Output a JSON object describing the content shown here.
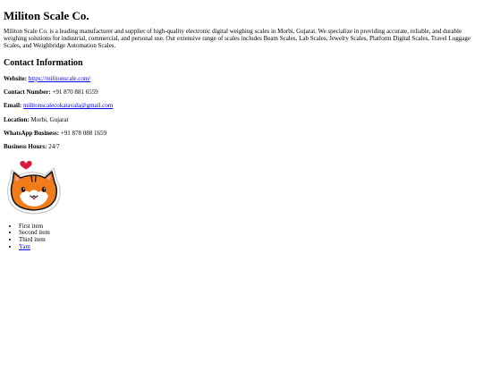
{
  "page": {
    "title": "Militon Scale Co.",
    "description": "Militon Scale Co. is a leading manufacturer and supplier of high-quality electronic digital weighing scales in Morbi, Gujarat. We specialize in providing accurate, reliable, and durable weighing solutions for industrial, commercial, and personal use. Our extensive range of scales includes Beam Scales, Lab Scales, Jewelry Scales, Platform Digital Scales, Travel Luggage Scales, and Weighbridge Automation Scales."
  },
  "contact": {
    "heading": "Contact Information",
    "website_label": "Website:",
    "website_value": "https://militonscale.com/",
    "phone_label": "Contact Number:",
    "phone_value": " +91 870 881 6559",
    "email_label": "Email:",
    "email_value": "militonscalecokatavala@gmail.com",
    "location_label": "Location:",
    "location_value": " Morbi, Gujarat",
    "whatsapp_label": "WhatsApp Business:",
    "whatsapp_value": " +91 878 088 1659",
    "hours_label": "Business Hours:",
    "hours_value": " 24/7"
  },
  "sticker": {
    "icon": "cat-with-heart-icon",
    "colors": {
      "fur": "#f07d1a",
      "outline": "#1a1a1a",
      "heart": "#d81b3a"
    }
  },
  "list": {
    "items": [
      "First item",
      "Second item",
      "Third item"
    ],
    "link_item": "Yam"
  }
}
